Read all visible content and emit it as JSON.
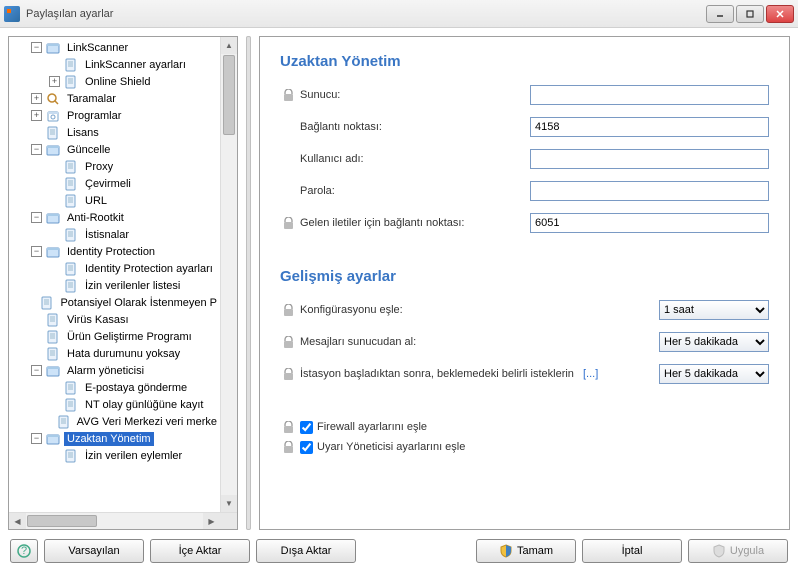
{
  "window": {
    "title": "Paylaşılan ayarlar"
  },
  "tree": [
    {
      "lvl": 1,
      "exp": "-",
      "icon": "folder",
      "label": "LinkScanner"
    },
    {
      "lvl": 2,
      "exp": "",
      "icon": "page",
      "label": "LinkScanner ayarları"
    },
    {
      "lvl": 2,
      "exp": "+",
      "icon": "page",
      "label": "Online Shield"
    },
    {
      "lvl": 1,
      "exp": "+",
      "icon": "search",
      "label": "Taramalar"
    },
    {
      "lvl": 1,
      "exp": "+",
      "icon": "calendar",
      "label": "Programlar"
    },
    {
      "lvl": 1,
      "exp": "",
      "icon": "page",
      "label": "Lisans"
    },
    {
      "lvl": 1,
      "exp": "-",
      "icon": "folder",
      "label": "Güncelle"
    },
    {
      "lvl": 2,
      "exp": "",
      "icon": "page",
      "label": "Proxy"
    },
    {
      "lvl": 2,
      "exp": "",
      "icon": "page",
      "label": "Çevirmeli"
    },
    {
      "lvl": 2,
      "exp": "",
      "icon": "page",
      "label": "URL"
    },
    {
      "lvl": 1,
      "exp": "-",
      "icon": "folder",
      "label": "Anti-Rootkit"
    },
    {
      "lvl": 2,
      "exp": "",
      "icon": "page",
      "label": "İstisnalar"
    },
    {
      "lvl": 1,
      "exp": "-",
      "icon": "folder",
      "label": "Identity Protection"
    },
    {
      "lvl": 2,
      "exp": "",
      "icon": "page",
      "label": "Identity Protection ayarları"
    },
    {
      "lvl": 2,
      "exp": "",
      "icon": "page",
      "label": "İzin verilenler listesi"
    },
    {
      "lvl": 1,
      "exp": "",
      "icon": "page",
      "label": "Potansiyel Olarak İstenmeyen P"
    },
    {
      "lvl": 1,
      "exp": "",
      "icon": "page",
      "label": "Virüs Kasası"
    },
    {
      "lvl": 1,
      "exp": "",
      "icon": "page",
      "label": "Ürün Geliştirme Programı"
    },
    {
      "lvl": 1,
      "exp": "",
      "icon": "page",
      "label": "Hata durumunu yoksay"
    },
    {
      "lvl": 1,
      "exp": "-",
      "icon": "folder",
      "label": "Alarm yöneticisi"
    },
    {
      "lvl": 2,
      "exp": "",
      "icon": "page",
      "label": "E-postaya gönderme"
    },
    {
      "lvl": 2,
      "exp": "",
      "icon": "page",
      "label": "NT olay günlüğüne kayıt"
    },
    {
      "lvl": 2,
      "exp": "",
      "icon": "page",
      "label": "AVG Veri Merkezi veri merke"
    },
    {
      "lvl": 1,
      "exp": "-",
      "icon": "folder",
      "label": "Uzaktan Yönetim",
      "selected": true
    },
    {
      "lvl": 2,
      "exp": "",
      "icon": "page",
      "label": "İzin verilen eylemler"
    }
  ],
  "content": {
    "section1_title": "Uzaktan Yönetim",
    "server_label": "Sunucu:",
    "server_value": "",
    "port_label": "Bağlantı noktası:",
    "port_value": "4158",
    "user_label": "Kullanıcı adı:",
    "user_value": "",
    "password_label": "Parola:",
    "password_value": "",
    "incoming_label": "Gelen iletiler için bağlantı noktası:",
    "incoming_value": "6051",
    "section2_title": "Gelişmiş ayarlar",
    "sync_config_label": "Konfigürasyonu eşle:",
    "sync_config_value": "1 saat",
    "retrieve_label": "Mesajları sunucudan al:",
    "retrieve_value": "Her 5 dakikada",
    "station_label": "İstasyon başladıktan sonra, beklemedeki belirli isteklerin",
    "station_ellipsis": "[...]",
    "station_value": "Her 5 dakikada",
    "firewall_checkbox": "Firewall ayarlarını eşle",
    "alert_checkbox": "Uyarı Yöneticisi ayarlarını eşle"
  },
  "buttons": {
    "defaults": "Varsayılan",
    "import": "İçe Aktar",
    "export": "Dışa Aktar",
    "ok": "Tamam",
    "cancel": "İptal",
    "apply": "Uygula"
  }
}
